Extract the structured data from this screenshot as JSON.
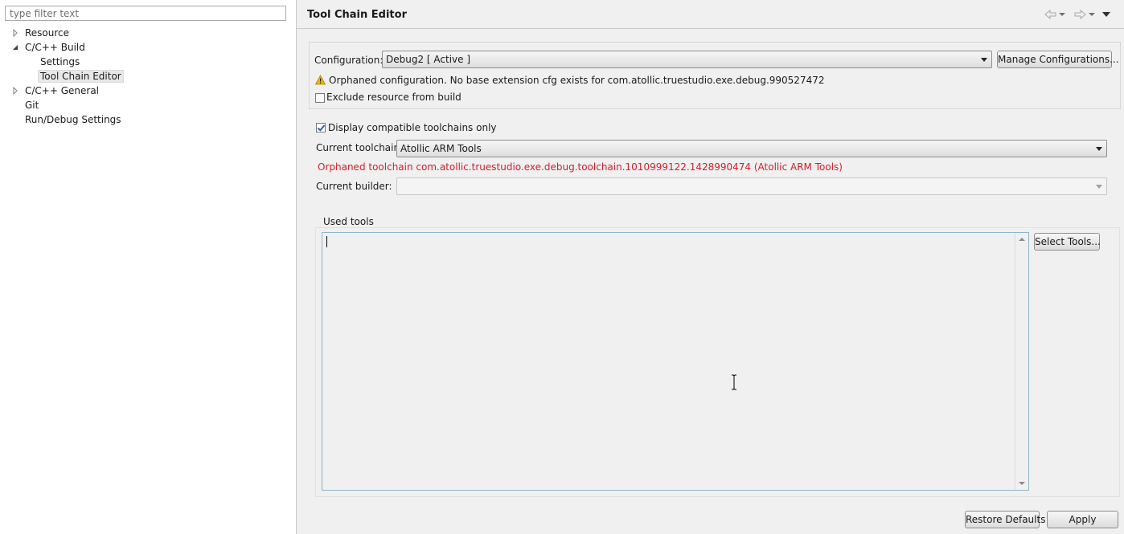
{
  "filter": {
    "placeholder": "type filter text"
  },
  "tree": {
    "items": [
      {
        "label": "Resource"
      },
      {
        "label": "C/C++ Build"
      },
      {
        "label": "Settings"
      },
      {
        "label": "Tool Chain Editor"
      },
      {
        "label": "C/C++ General"
      },
      {
        "label": "Git"
      },
      {
        "label": "Run/Debug Settings"
      }
    ]
  },
  "page": {
    "title": "Tool Chain Editor",
    "configuration": {
      "label": "Configuration:",
      "value": "Debug2  [ Active ]",
      "manage_button": "Manage Configurations...",
      "warning": "Orphaned configuration. No base extension cfg exists for com.atollic.truestudio.exe.debug.990527472",
      "exclude_label": "Exclude resource from build",
      "exclude_checked": false
    },
    "display_compatible_label": "Display compatible toolchains only",
    "display_compatible_checked": true,
    "current_toolchain_label": "Current toolchain:",
    "current_toolchain_value": "Atollic ARM Tools",
    "orphaned_toolchain": "Orphaned toolchain com.atollic.truestudio.exe.debug.toolchain.1010999122.1428990474 (Atollic ARM Tools)",
    "current_builder_label": "Current builder:",
    "current_builder_value": "",
    "used_tools_label": "Used tools",
    "select_tools_button": "Select Tools...",
    "restore_defaults_button": "Restore Defaults",
    "apply_button": "Apply"
  },
  "colors": {
    "error": "#d2202a",
    "warning": "#f0b400"
  }
}
